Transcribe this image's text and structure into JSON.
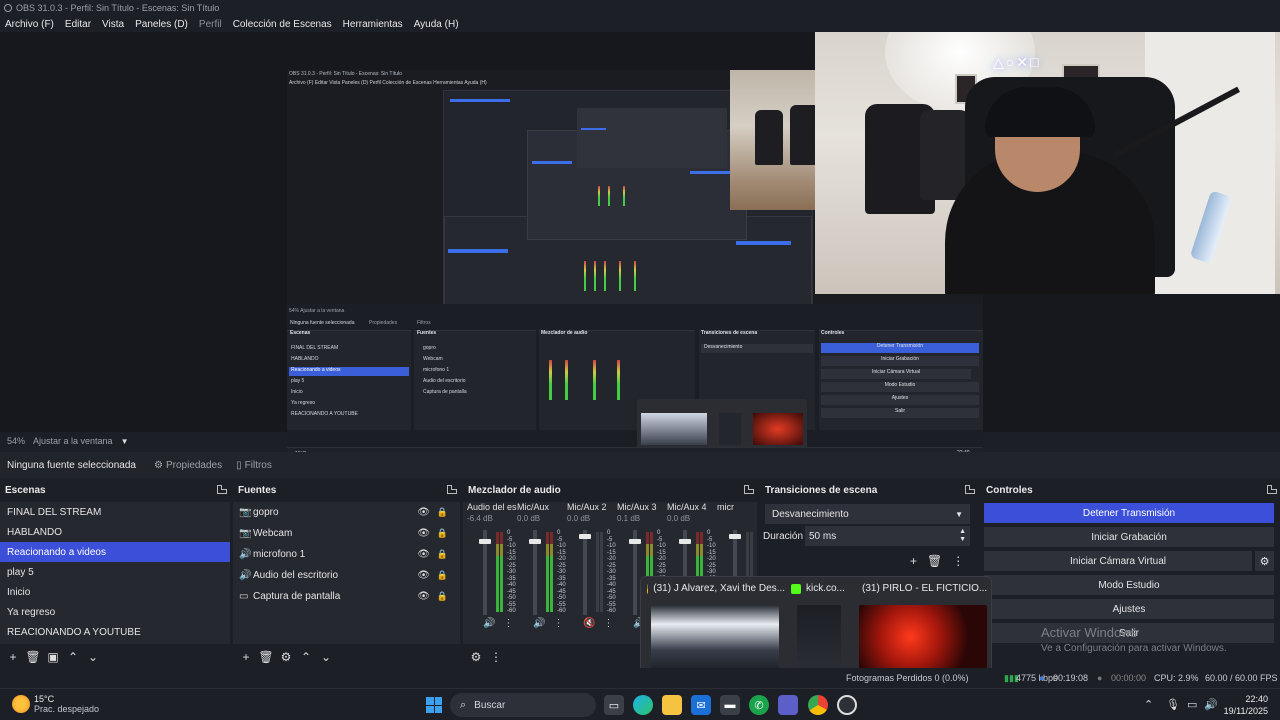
{
  "window": {
    "title": "OBS 31.0.3 - Perfil: Sin Título - Escenas: Sin Título"
  },
  "menu": [
    {
      "label": "Archivo (F)",
      "enabled": true
    },
    {
      "label": "Editar",
      "enabled": true
    },
    {
      "label": "Vista",
      "enabled": true
    },
    {
      "label": "Paneles (D)",
      "enabled": true
    },
    {
      "label": "Perfil",
      "enabled": false
    },
    {
      "label": "Colección de Escenas",
      "enabled": true
    },
    {
      "label": "Herramientas",
      "enabled": true
    },
    {
      "label": "Ayuda (H)",
      "enabled": true
    }
  ],
  "preview": {
    "zoom": "54%",
    "zoom_label": "Ajustar a la ventana",
    "inner_menu": "Archivo (F)   Editar   Vista   Paneles (D)   Perfil   Colección de Escenas   Herramientas   Ayuda (H)",
    "inner_title": "OBS 31.0.3 - Perfil: Sin Título - Escenas: Sin Título"
  },
  "source_toolbar": {
    "no_source": "Ninguna fuente seleccionada",
    "properties": "Propiedades",
    "filters": "Filtros"
  },
  "scenes": {
    "title": "Escenas",
    "items": [
      "FINAL DEL STREAM",
      "HABLANDO",
      "Reacionando a videos",
      "play 5",
      "Inicio",
      "Ya regreso",
      "REACIONANDO A YOUTUBE"
    ],
    "active_index": 2
  },
  "sources": {
    "title": "Fuentes",
    "items": [
      {
        "label": "gopro",
        "icon": "camera-icon"
      },
      {
        "label": "Webcam",
        "icon": "camera-icon"
      },
      {
        "label": "microfono 1",
        "icon": "speaker-icon"
      },
      {
        "label": "Audio del escritorio",
        "icon": "speaker-icon"
      },
      {
        "label": "Captura de pantalla",
        "icon": "monitor-icon"
      }
    ]
  },
  "mixer": {
    "title": "Mezclador de audio",
    "scale": [
      "0",
      "-5",
      "-10",
      "-15",
      "-20",
      "-25",
      "-30",
      "-35",
      "-40",
      "-45",
      "-50",
      "-55",
      "-60"
    ],
    "channels": [
      {
        "name": "Audio del escritorio",
        "db": "-6.4 dB",
        "level": 0.45,
        "muted": false
      },
      {
        "name": "Mic/Aux",
        "db": "0.0 dB",
        "level": 0.8,
        "muted": false
      },
      {
        "name": "Mic/Aux 2",
        "db": "0.0 dB",
        "level": 0.0,
        "muted": true
      },
      {
        "name": "Mic/Aux 3",
        "db": "0.1 dB",
        "level": 0.3,
        "muted": false
      },
      {
        "name": "Mic/Aux 4",
        "db": "0.0 dB",
        "level": 0.2,
        "muted": false
      },
      {
        "name": "micr",
        "db": "",
        "level": 0.0,
        "muted": false
      }
    ]
  },
  "transitions": {
    "title": "Transiciones de escena",
    "selected": "Desvanecimiento",
    "duration_label": "Duración",
    "duration_value": "50 ms"
  },
  "controls": {
    "title": "Controles",
    "buttons": [
      "Detener Transmisión",
      "Iniciar Grabación",
      "Iniciar Cámara Virtual",
      "Modo Estudio",
      "Ajustes",
      "Salir"
    ]
  },
  "taskbar_previews": [
    {
      "title": "(31) J Alvarez, Xavi the Des...",
      "icon_color": "#e8e8e8"
    },
    {
      "title": "kick.co...",
      "icon_color": "#53fc18"
    },
    {
      "title": "(31) PIRLO - EL FICTICIO...",
      "icon_color": "#e8e8e8"
    }
  ],
  "watermark": {
    "title": "Activar Windows",
    "subtitle": "Ve a Configuración para activar Windows."
  },
  "status": {
    "dropped": "Fotogramas Perdidos 0 (0.0%)",
    "kbps": "4775 kbps",
    "live_time": "00:19:08",
    "rec_time": "00:00:00",
    "cpu": "CPU: 2.9%",
    "fps": "60.00 / 60.00 FPS"
  },
  "taskbar": {
    "temp": "15°C",
    "condition": "Prac. despejado",
    "search": "Buscar",
    "time": "22:40",
    "date": "19/11/2025"
  },
  "colors": {
    "accent": "#3b4fd9",
    "panel": "#262830",
    "background": "#1d1f26"
  }
}
